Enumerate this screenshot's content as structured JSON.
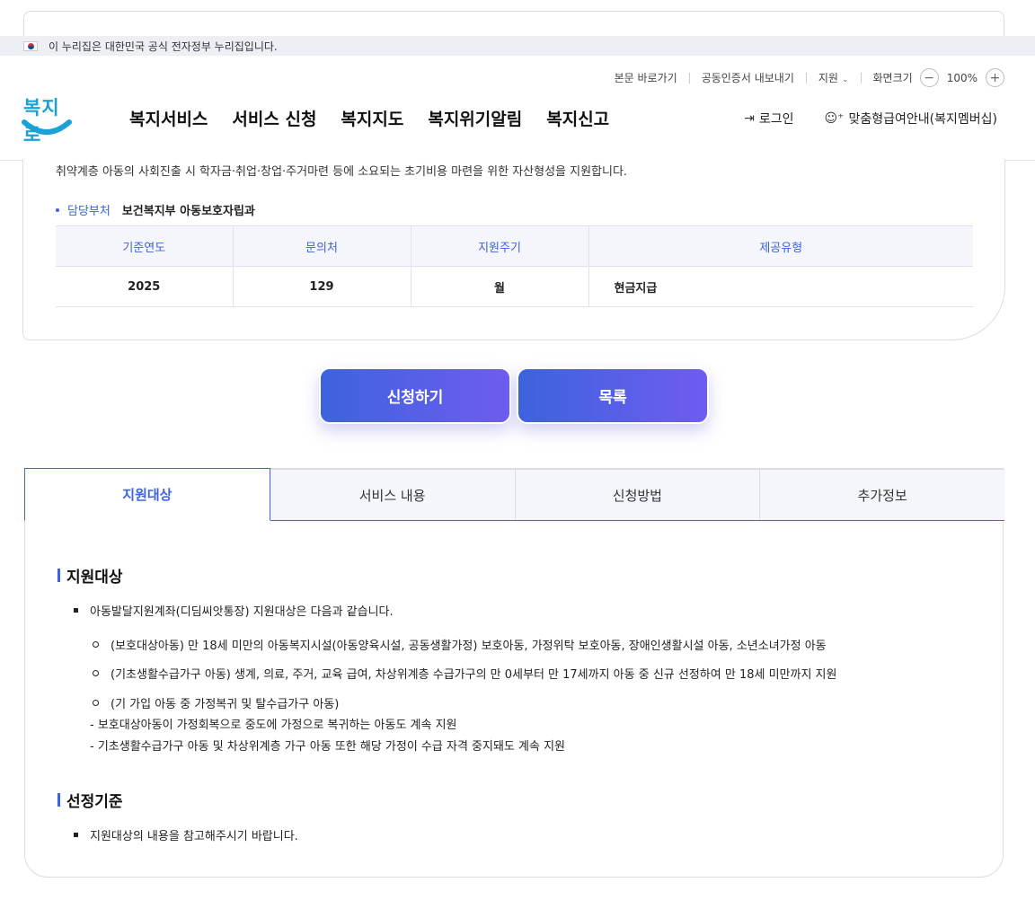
{
  "gov_notice": "이 누리집은 대한민국 공식 전자정부 누리집입니다.",
  "util": {
    "skip": "본문 바로가기",
    "cert": "공동인증서 내보내기",
    "support": "지원",
    "screen_size": "화면크기",
    "zoom_minus": "−",
    "zoom_value": "100%",
    "zoom_plus": "+"
  },
  "logo_text": "복지로",
  "nav": [
    "복지서비스",
    "서비스 신청",
    "복지지도",
    "복지위기알림",
    "복지신고"
  ],
  "header_right": {
    "login": "로그인",
    "membership": "맞춤형급여안내(복지멤버십)"
  },
  "service": {
    "description": "취약계층 아동의 사회진출 시 학자금·취업·창업·주거마련 등에 소요되는 초기비용 마련을 위한 자산형성을 지원합니다.",
    "dept_label": "담당부처",
    "dept_value": "보건복지부 아동보호자립과",
    "table": {
      "headers": [
        "기준연도",
        "문의처",
        "지원주기",
        "제공유형"
      ],
      "row": [
        "2025",
        "129",
        "월",
        "현금지급"
      ]
    }
  },
  "buttons": {
    "apply": "신청하기",
    "list": "목록"
  },
  "tabs": [
    "지원대상",
    "서비스 내용",
    "신청방법",
    "추가정보"
  ],
  "content": {
    "section1_title": "지원대상",
    "section1_intro": "아동발달지원계좌(디딤씨앗통장) 지원대상은 다음과 같습니다.",
    "section1_items": [
      "(보호대상아동) 만 18세 미만의 아동복지시설(아동양육시설, 공동생활가정) 보호아동, 가정위탁 보호아동, 장애인생활시설 아동, 소년소녀가정 아동",
      "(기초생활수급가구 아동) 생계, 의료, 주거, 교육 급여, 차상위계층 수급가구의 만 0세부터 만 17세까지 아동 중 신규 선정하여 만 18세 미만까지 지원",
      "(기 가입 아동 중 가정복귀 및 탈수급가구 아동)"
    ],
    "section1_notes": [
      "- 보호대상아동이 가정회복으로 중도에 가정으로 복귀하는 아동도 계속 지원",
      "- 기초생활수급가구 아동 및 차상위계층 가구 아동 또한 해당 가정이 수급 자격 중지돼도 계속 지원"
    ],
    "section2_title": "선정기준",
    "section2_text": "지원대상의 내용을 참고해주시기 바랍니다."
  }
}
